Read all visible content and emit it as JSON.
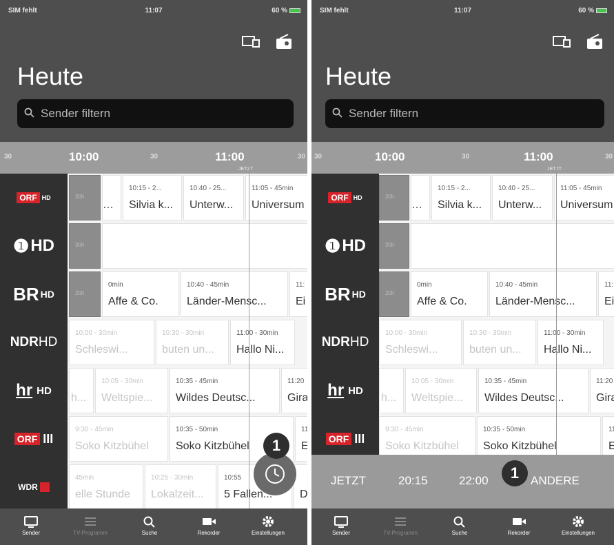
{
  "status": {
    "carrier": "SIM fehlt",
    "time": "11:07",
    "battery": "60 %"
  },
  "header": {
    "title": "Heute",
    "search_placeholder": "Sender filtern"
  },
  "timeline": {
    "ticks": [
      "10:00",
      "11:00"
    ],
    "minor_30": "30",
    "now_label": "JETZT"
  },
  "channels": [
    {
      "name": "ORF 1 HD",
      "logo": "ORF"
    },
    {
      "name": "Das Erste HD",
      "logo": "HD"
    },
    {
      "name": "BR HD",
      "logo": "BR"
    },
    {
      "name": "NDR HD",
      "logo": "NDR"
    },
    {
      "name": "hr HD",
      "logo": "hr"
    },
    {
      "name": "ORF III",
      "logo": "ORF"
    },
    {
      "name": "WDR HD",
      "logo": "WDR"
    }
  ],
  "programs": {
    "orf1": [
      {
        "time": "30h"
      },
      {
        "time": "10:15 - 2...",
        "title": "Silvia k..."
      },
      {
        "time": "10:40 - 25...",
        "title": "Unterw..."
      },
      {
        "time": "11:05 - 45min",
        "title": "Universum"
      }
    ],
    "ard": [
      {
        "time": "30h"
      }
    ],
    "br": [
      {
        "time": "20h"
      },
      {
        "time": "0min",
        "title": "Affe & Co."
      },
      {
        "time": "10:40 - 45min",
        "title": "Länder-Mensc..."
      },
      {
        "time": "11:",
        "title": "Ei"
      }
    ],
    "ndr": [
      {
        "time": "10:00 - 30min",
        "title": "Schleswi..."
      },
      {
        "time": "10:30 - 30min",
        "title": "buten un..."
      },
      {
        "time": "11:00 - 30min",
        "title": "Hallo Ni..."
      }
    ],
    "hr": [
      {
        "title": "h..."
      },
      {
        "time": "10:05 - 30min",
        "title": "Weltspie..."
      },
      {
        "time": "10:35 - 45min",
        "title": "Wildes Deutsc..."
      },
      {
        "time": "11:20",
        "title": "Gira"
      }
    ],
    "orf3": [
      {
        "time": "9:30 - 45min",
        "title": "Soko Kitzbühel"
      },
      {
        "time": "10:35 - 50min",
        "title": "Soko Kitzbühel"
      },
      {
        "time": "11:",
        "title": "Ex"
      }
    ],
    "wdr": [
      {
        "time": "45min",
        "title": "elle Stunde"
      },
      {
        "time": "10:25 - 30min",
        "title": "Lokalzeit..."
      },
      {
        "time": "10:55",
        "title": "5 Fallen..."
      },
      {
        "title": "Da"
      }
    ]
  },
  "badge_number": "1",
  "quick_times": {
    "now": "JETZT",
    "t1": "20:15",
    "t2": "22:00",
    "other": "ANDERE"
  },
  "tabs": [
    {
      "label": "Sender",
      "icon": "tv-icon"
    },
    {
      "label": "TV-Programm",
      "icon": "list-icon"
    },
    {
      "label": "Suche",
      "icon": "search-icon"
    },
    {
      "label": "Rekorder",
      "icon": "camera-icon"
    },
    {
      "label": "Einstellungen",
      "icon": "gear-icon"
    }
  ],
  "colors": {
    "header": "#4e4e4e",
    "timebar": "#9c9c9c",
    "orf_red": "#d7232a",
    "badge": "#2e2e2e"
  }
}
